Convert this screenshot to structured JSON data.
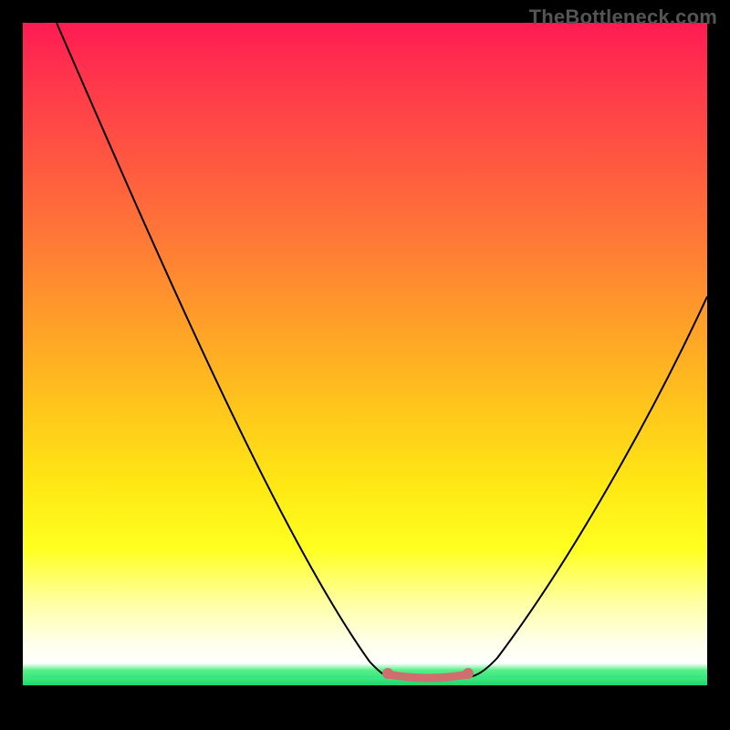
{
  "watermark": "TheBottleneck.com",
  "chart_data": {
    "type": "line",
    "title": "",
    "xlabel": "",
    "ylabel": "",
    "xlim": [
      0,
      100
    ],
    "ylim": [
      0,
      100
    ],
    "grid": false,
    "legend": false,
    "series": [
      {
        "name": "bottleneck-curve",
        "x": [
          5,
          10,
          15,
          20,
          25,
          30,
          35,
          40,
          45,
          50,
          53,
          58,
          62,
          65,
          70,
          75,
          80,
          85,
          90,
          95,
          100
        ],
        "y": [
          100,
          89,
          78,
          67,
          57,
          47,
          38,
          29,
          21,
          13,
          7,
          3,
          3,
          3,
          6,
          14,
          24,
          34,
          44,
          53,
          62
        ]
      },
      {
        "name": "optimal-range",
        "x": [
          53,
          65
        ],
        "y": [
          3,
          3
        ]
      }
    ],
    "annotations": []
  }
}
